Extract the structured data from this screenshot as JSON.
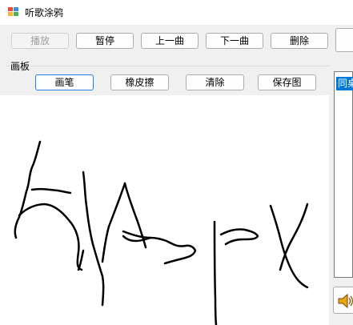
{
  "window": {
    "title": "听歌涂鸦"
  },
  "player_controls": {
    "play": "播放",
    "pause": "暂停",
    "prev": "上一曲",
    "next": "下一曲",
    "delete": "删除"
  },
  "board": {
    "group_label": "画板",
    "pen": "画笔",
    "eraser": "橡皮擦",
    "clear": "清除",
    "save": "保存图"
  },
  "playlist": {
    "selected_item": "同桌"
  },
  "colors": {
    "accent": "#0078d7",
    "selected_border": "#2c7be5",
    "canvas": "#ffffff"
  },
  "icons": {
    "app": "app-icon",
    "speaker": "speaker-icon"
  }
}
